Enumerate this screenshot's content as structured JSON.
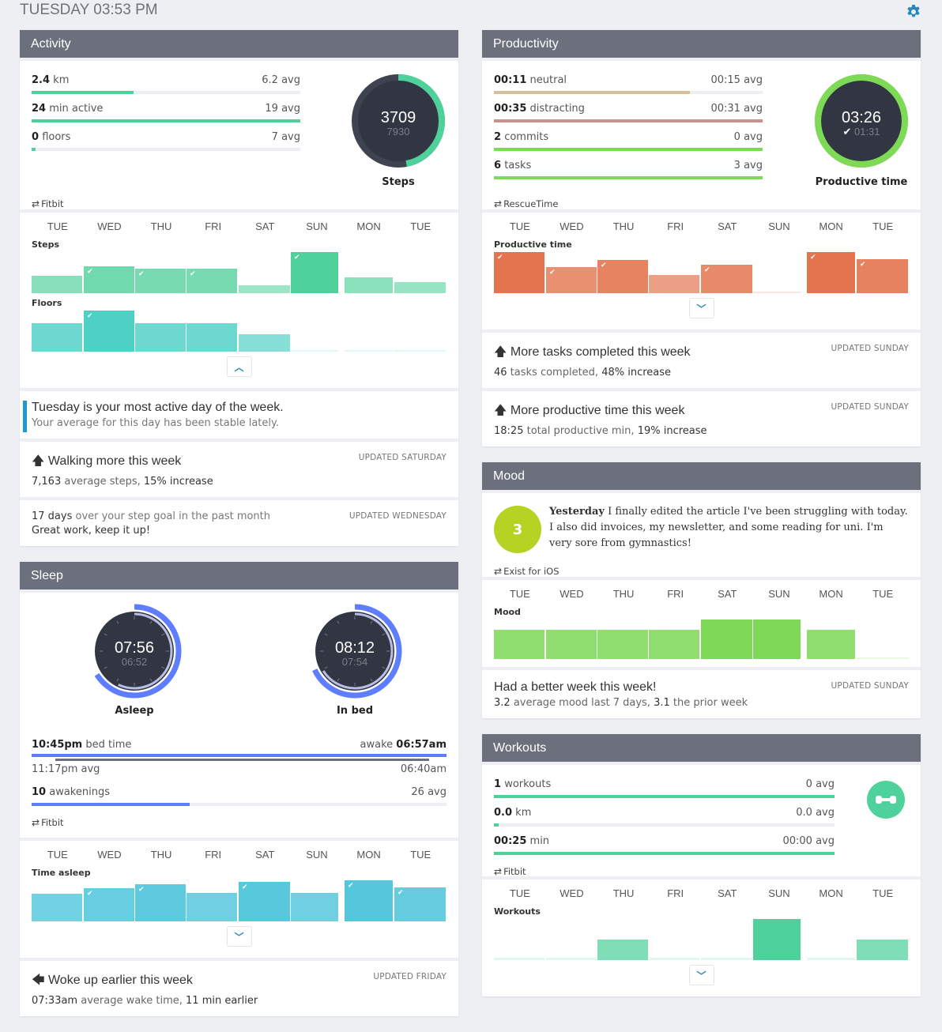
{
  "header": {
    "datetime": "TUESDAY 03:53 PM",
    "settings_icon": "gear-icon"
  },
  "colors": {
    "panel_header": "#6b707c",
    "steps_green": "#4fd19b",
    "floors_teal": "#4fd0c5",
    "productive_orange": "#e3744d",
    "mood_green": "#7ed957",
    "sleep_blue": "#5f7dff",
    "sleep_bar": "#54c7dc",
    "workouts_green": "#4fd19b",
    "neutral_tan": "#d4c39a",
    "distracting_rose": "#c9928a",
    "mood_dot": "#b6d223",
    "accent": "#2a87b5"
  },
  "day_labels": [
    "TUE",
    "WED",
    "THU",
    "FRI",
    "SAT",
    "SUN",
    "MON",
    "TUE"
  ],
  "activity": {
    "title": "Activity",
    "metrics": [
      {
        "value": "2.4",
        "unit": "km",
        "avg": "6.2 avg",
        "progress": 0.38
      },
      {
        "value": "24",
        "unit": "min active",
        "avg": "19 avg",
        "progress": 1.0
      },
      {
        "value": "0",
        "unit": "floors",
        "avg": "7 avg",
        "progress": 0.015
      }
    ],
    "ring": {
      "value": "3709",
      "goal": "7930",
      "label": "Steps",
      "progress": 0.47
    },
    "source": "Fitbit",
    "charts": [
      {
        "label": "Steps",
        "values": [
          0.42,
          0.66,
          0.6,
          0.6,
          0.2,
          1.0,
          0.38,
          0.26
        ],
        "checks": [
          false,
          true,
          true,
          true,
          false,
          true,
          false,
          false
        ]
      },
      {
        "label": "Floors",
        "values": [
          0.7,
          1.0,
          0.7,
          0.7,
          0.42,
          0.04,
          0.04,
          0.04
        ],
        "checks": [
          false,
          true,
          false,
          false,
          false,
          false,
          false,
          false
        ]
      }
    ],
    "toggle": "chevron-up",
    "callout": {
      "title": "Tuesday is your most active day of the week.",
      "sub": "Your average for this day has been stable lately."
    },
    "insights": [
      {
        "icon": "arrow-up",
        "title": "Walking more this week",
        "sub_strong1": "7,163",
        "sub_text1": " average steps, ",
        "sub_strong2": "15% increase",
        "updated": "UPDATED SATURDAY"
      },
      {
        "icon": "",
        "title_strong": "17 days",
        "title_rest": " over your step goal in the past month",
        "sub": "Great work, keep it up!",
        "updated": "UPDATED WEDNESDAY"
      }
    ]
  },
  "sleep": {
    "title": "Sleep",
    "gauges": [
      {
        "value": "07:56",
        "avg": "06:52",
        "label": "Asleep",
        "progress": 0.66,
        "avg_progress": 0.57
      },
      {
        "value": "08:12",
        "avg": "07:54",
        "label": "In bed",
        "progress": 0.68,
        "avg_progress": 0.66
      }
    ],
    "bedtime": {
      "value": "10:45pm",
      "label": "bed time",
      "awake_label": "awake",
      "awake_value": "06:57am",
      "avg_bed": "11:17pm avg",
      "avg_wake": "06:40am"
    },
    "awakenings": {
      "value": "10",
      "unit": "awakenings",
      "avg": "26 avg",
      "progress": 0.38
    },
    "source": "Fitbit",
    "chart": {
      "label": "Time asleep",
      "values": [
        0.68,
        0.8,
        0.9,
        0.7,
        0.96,
        0.7,
        1.0,
        0.82
      ],
      "checks": [
        false,
        true,
        true,
        false,
        true,
        false,
        true,
        true
      ]
    },
    "toggle": "chevron-down",
    "insight": {
      "icon": "arrow-left",
      "title": "Woke up earlier this week",
      "sub_strong1": "07:33am",
      "sub_text1": " average wake time, ",
      "sub_strong2": "11 min earlier",
      "updated": "UPDATED FRIDAY"
    }
  },
  "productivity": {
    "title": "Productivity",
    "metrics": [
      {
        "value": "00:11",
        "unit": "neutral",
        "avg": "00:15 avg",
        "progress": 0.73,
        "color": "#d4c39a"
      },
      {
        "value": "00:35",
        "unit": "distracting",
        "avg": "00:31 avg",
        "progress": 1.0,
        "color": "#c9928a"
      },
      {
        "value": "2",
        "unit": "commits",
        "avg": "0 avg",
        "progress": 1.0,
        "color": "#7ed957"
      },
      {
        "value": "6",
        "unit": "tasks",
        "avg": "3 avg",
        "progress": 1.0,
        "color": "#7ed957"
      }
    ],
    "ring": {
      "value": "03:26",
      "goal": "01:31",
      "label": "Productive time",
      "progress": 1.0
    },
    "source": "RescueTime",
    "chart": {
      "label": "Productive time",
      "values": [
        1.0,
        0.64,
        0.8,
        0.44,
        0.7,
        0.02,
        1.0,
        0.82
      ],
      "checks": [
        true,
        true,
        true,
        false,
        true,
        false,
        true,
        true
      ]
    },
    "toggle": "chevron-down",
    "insights": [
      {
        "icon": "arrow-up",
        "title": "More tasks completed this week",
        "sub_strong1": "46",
        "sub_text1": " tasks completed, ",
        "sub_strong2": "48% increase",
        "updated": "UPDATED SUNDAY"
      },
      {
        "icon": "arrow-up",
        "title": "More productive time this week",
        "sub_strong1": "18:25",
        "sub_text1": " total productive min, ",
        "sub_strong2": "19% increase",
        "updated": "UPDATED SUNDAY"
      }
    ]
  },
  "mood": {
    "title": "Mood",
    "rating": "3",
    "note_strong": "Yesterday",
    "note": " I finally edited the article I've been struggling with today. I also did invoices, my newsletter, and some reading for uni. I'm very sore from gymnastics!",
    "source": "Exist for iOS",
    "chart": {
      "label": "Mood",
      "values": [
        0.74,
        0.74,
        0.74,
        0.74,
        1.0,
        1.0,
        0.74,
        0.02
      ],
      "checks": [
        false,
        false,
        false,
        false,
        false,
        false,
        false,
        false
      ]
    },
    "insight": {
      "icon": "",
      "title": "Had a better week this week!",
      "sub_strong1": "3.2",
      "sub_text1": " average mood last 7 days, ",
      "sub_strong2": "3.1",
      "sub_text2": " the prior week",
      "updated": "UPDATED SUNDAY"
    }
  },
  "workouts": {
    "title": "Workouts",
    "metrics": [
      {
        "value": "1",
        "unit": "workouts",
        "avg": "0 avg",
        "progress": 1.0
      },
      {
        "value": "0.0",
        "unit": "km",
        "avg": "0.0 avg",
        "progress": 0.015
      },
      {
        "value": "00:25",
        "unit": "min",
        "avg": "00:00 avg",
        "progress": 1.0
      }
    ],
    "icon": "dumbbell-icon",
    "source": "Fitbit",
    "chart": {
      "label": "Workouts",
      "values": [
        0.06,
        0.06,
        0.5,
        0.06,
        0.06,
        1.0,
        0.06,
        0.5
      ],
      "checks": [
        false,
        false,
        false,
        false,
        false,
        false,
        false,
        false
      ]
    },
    "toggle": "chevron-down"
  }
}
